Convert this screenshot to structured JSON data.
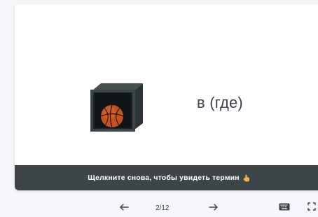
{
  "card": {
    "term": "в (где)",
    "image_icon": "basketball-in-box-icon"
  },
  "hint": {
    "text": "Щелкните снова, чтобы увидеть термин",
    "icon": "pointing-hand-icon"
  },
  "navigation": {
    "counter": "2/12",
    "prev_icon": "arrow-left-icon",
    "next_icon": "arrow-right-icon",
    "keyboard_icon": "keyboard-icon",
    "fullscreen_icon": "fullscreen-icon"
  },
  "colors": {
    "hint_bar": "#3d4547",
    "text": "#3c4150",
    "card": "#ffffff"
  }
}
